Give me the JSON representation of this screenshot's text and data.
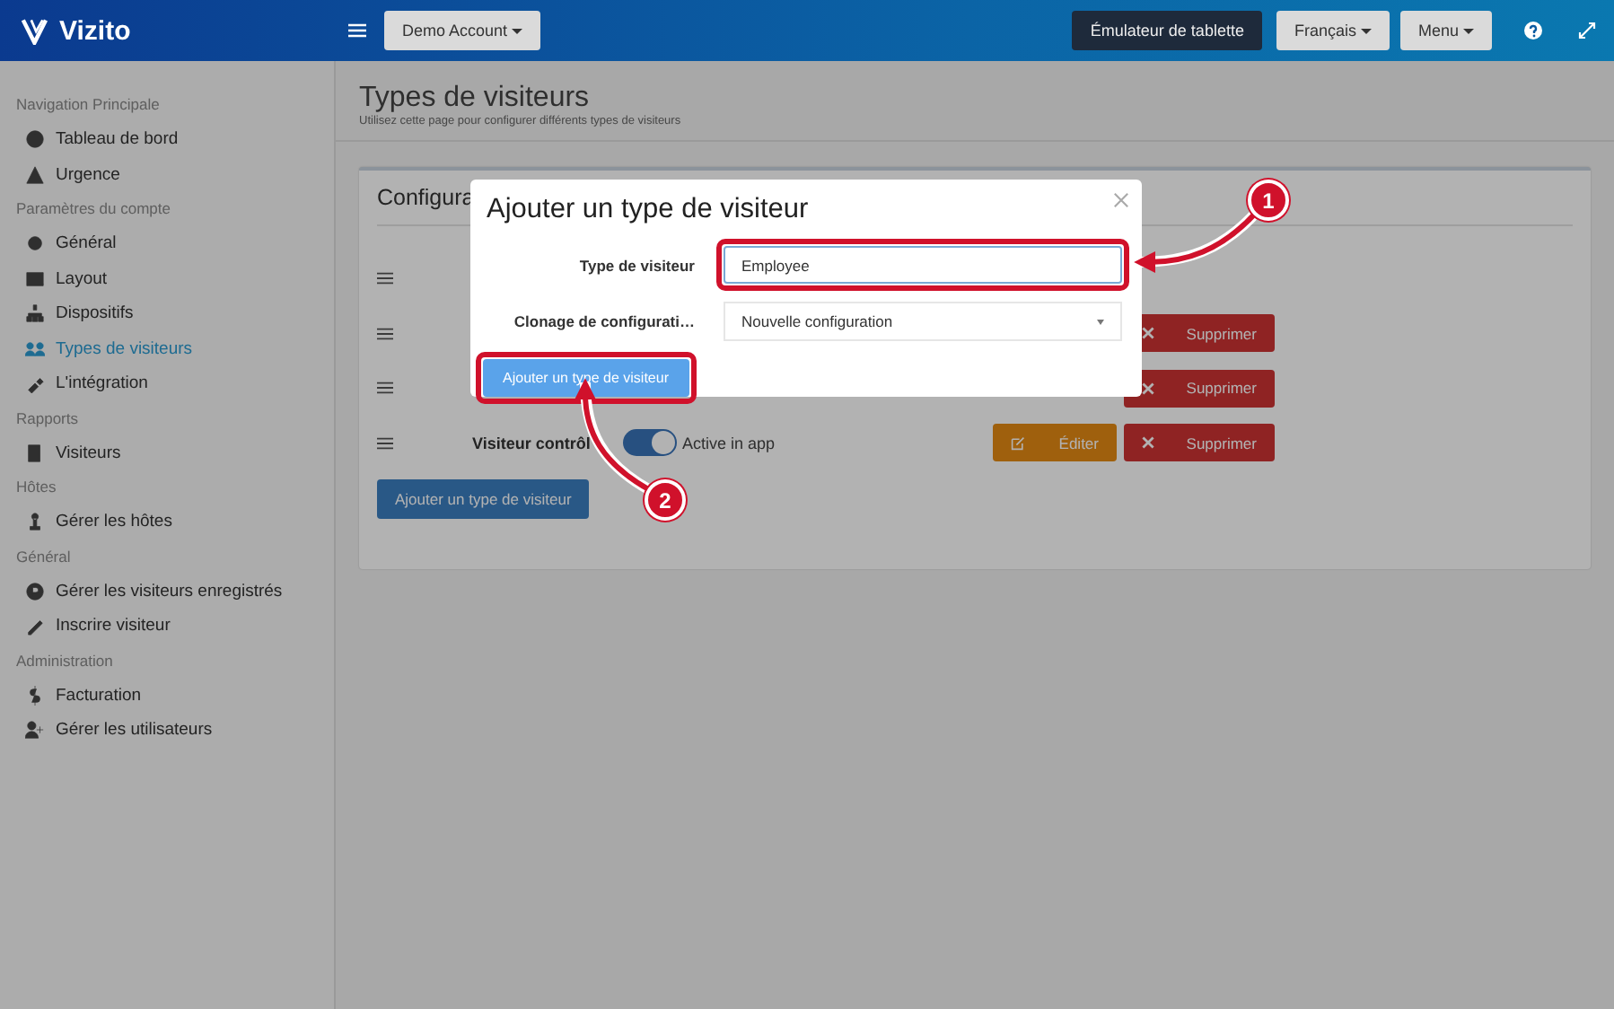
{
  "topbar": {
    "logo": "Vizito",
    "account_button": "Demo Account",
    "tablet_button": "Émulateur de tablette",
    "language_button": "Français",
    "menu_button": "Menu"
  },
  "sidebar": [
    {
      "title": "Navigation Principale",
      "items": [
        {
          "label": "Tableau de bord",
          "selected": false
        },
        {
          "label": "Urgence",
          "selected": false
        }
      ]
    },
    {
      "title": "Paramètres du compte",
      "items": [
        {
          "label": "Général",
          "selected": false
        },
        {
          "label": "Layout",
          "selected": false
        },
        {
          "label": "Dispositifs",
          "selected": false
        },
        {
          "label": "Types de visiteurs",
          "selected": true
        },
        {
          "label": "L'intégration",
          "selected": false
        }
      ]
    },
    {
      "title": "Rapports",
      "items": [
        {
          "label": "Visiteurs",
          "selected": false
        }
      ]
    },
    {
      "title": "Hôtes",
      "items": [
        {
          "label": "Gérer les hôtes",
          "selected": false
        }
      ]
    },
    {
      "title": "Général",
      "items": [
        {
          "label": "Gérer les visiteurs enregistrés",
          "selected": false
        },
        {
          "label": "Inscrire visiteur",
          "selected": false
        }
      ]
    },
    {
      "title": "Administration",
      "items": [
        {
          "label": "Facturation",
          "selected": false
        },
        {
          "label": "Gérer les utilisateurs",
          "selected": false
        }
      ]
    }
  ],
  "page": {
    "title": "Types de visiteurs",
    "subtitle": "Utilisez cette page pour configurer différents types de visiteurs"
  },
  "card": {
    "title": "Configura",
    "rows": [
      {
        "draggable": true
      },
      {
        "draggable": true,
        "delete_button": "Supprimer"
      },
      {
        "draggable": true,
        "delete_button": "Supprimer"
      },
      {
        "draggable": true,
        "name": "Visiteur contrôl",
        "active": true,
        "toggle_label": "Active in app",
        "edit_button": "Éditer",
        "delete_button": "Supprimer"
      }
    ],
    "add_button": "Ajouter un type de visiteur"
  },
  "modal": {
    "title": "Ajouter un type de visiteur",
    "fields": [
      {
        "kind": "input",
        "label": "Type de visiteur",
        "value": "Employee",
        "highlighted": true
      },
      {
        "kind": "select",
        "label": "Clonage de configurati…",
        "value": "Nouvelle configuration",
        "highlighted": false
      }
    ],
    "submit_button": "Ajouter un type de visiteur",
    "submit_highlighted": true
  },
  "annotations": [
    {
      "number": "1"
    },
    {
      "number": "2"
    }
  ]
}
